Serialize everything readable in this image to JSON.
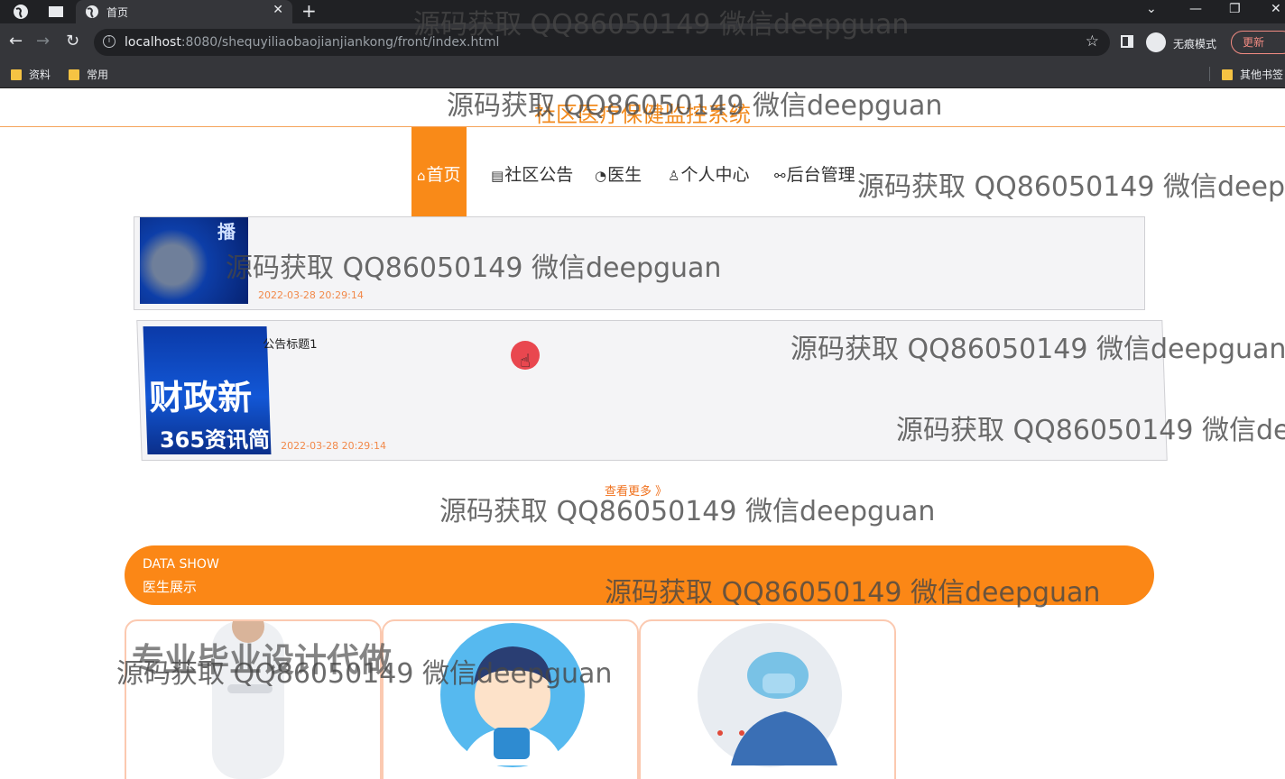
{
  "browser": {
    "tab_title": "首页",
    "tab_close": "✕",
    "new_tab": "+",
    "url_host": "localhost",
    "url_rest": ":8080/shequyiliaobaojianjiankong/front/index.html",
    "incognito_label": "无痕模式",
    "update_label": "更新",
    "bookmarks": [
      "资料",
      "常用"
    ],
    "other_bookmarks": "其他书签"
  },
  "site": {
    "title": "社区医疗保健监控系统"
  },
  "nav": {
    "items": [
      {
        "icon": "⌂",
        "label": "首页"
      },
      {
        "icon": "▤",
        "label": "社区公告"
      },
      {
        "icon": "◔",
        "label": "医生"
      },
      {
        "icon": "♙",
        "label": "个人中心"
      },
      {
        "icon": "⚯",
        "label": "后台管理"
      }
    ]
  },
  "notices": [
    {
      "title": "",
      "date": "2022-03-28 20:29:14",
      "thumb_text": "播"
    },
    {
      "title": "公告标题1",
      "date": "2022-03-28 20:29:14",
      "thumb_text_1": "财政新",
      "thumb_text_2": "365资讯简"
    }
  ],
  "more_link": "查看更多 》",
  "datashow": {
    "en": "DATA SHOW",
    "cn": "医生展示"
  },
  "watermark_text": "源码获取 QQ86050149 微信deepguan",
  "watermark_big": "专业毕业设计代做",
  "colors": {
    "accent": "#f98a18",
    "date": "#f2894a"
  }
}
